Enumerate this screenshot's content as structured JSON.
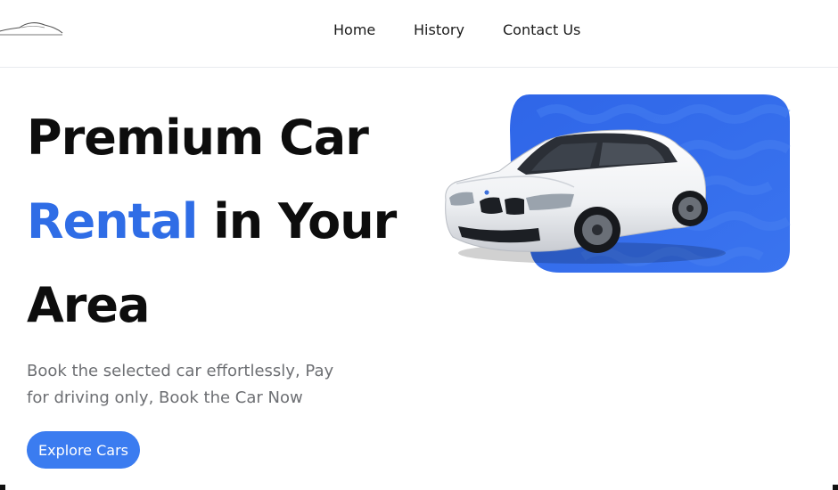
{
  "header": {
    "nav": [
      {
        "label": "Home"
      },
      {
        "label": "History"
      },
      {
        "label": "Contact Us"
      }
    ]
  },
  "hero": {
    "title_line1": "Premium Car",
    "title_accent": "Rental",
    "title_line2_rest": " in Your",
    "title_line3": "Area",
    "subtitle": "Book the selected car effortlessly, Pay for driving only, Book the Car Now",
    "cta_label": "Explore Cars"
  },
  "colors": {
    "accent": "#2f6de6",
    "button": "#3b7cf0",
    "panel": "#2f66e8",
    "subtitle": "#6d6f73"
  },
  "icons": {
    "logo": "car-outline-logo",
    "hero_image": "white-sedan-car"
  }
}
